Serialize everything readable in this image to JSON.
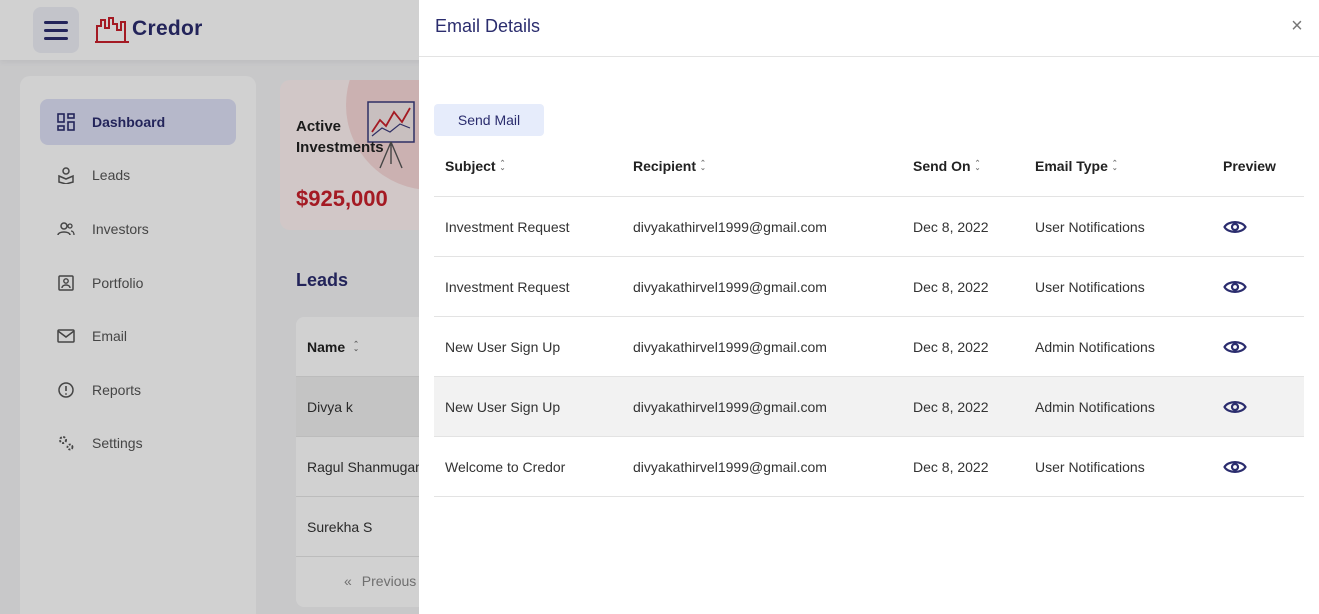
{
  "app": {
    "brand": "Credor",
    "colors": {
      "primary": "#2b2d6e",
      "accent_red": "#c8202b",
      "active_nav_bg": "#dfe1f7"
    }
  },
  "sidebar": {
    "items": [
      {
        "label": "Dashboard",
        "icon": "dashboard-icon",
        "active": true
      },
      {
        "label": "Leads",
        "icon": "leads-icon"
      },
      {
        "label": "Investors",
        "icon": "investors-icon"
      },
      {
        "label": "Portfolio",
        "icon": "portfolio-icon"
      },
      {
        "label": "Email",
        "icon": "email-icon"
      },
      {
        "label": "Reports",
        "icon": "reports-icon"
      },
      {
        "label": "Settings",
        "icon": "settings-icon"
      }
    ]
  },
  "dashboard": {
    "active_investments": {
      "title": "Active Investments",
      "amount": "$925,000"
    },
    "leads": {
      "title": "Leads",
      "column_name": "Name",
      "rows": [
        "Divya k",
        "Ragul Shanmugam",
        "Surekha S"
      ],
      "pagination_prev": "Previous"
    }
  },
  "drawer": {
    "title": "Email Details",
    "close_label": "×",
    "send_mail_label": "Send Mail",
    "columns": {
      "subject": "Subject",
      "recipient": "Recipient",
      "send_on": "Send On",
      "email_type": "Email Type",
      "preview": "Preview"
    },
    "rows": [
      {
        "subject": "Investment Request",
        "recipient": "divyakathirvel1999@gmail.com",
        "send_on": "Dec 8, 2022",
        "email_type": "User Notifications"
      },
      {
        "subject": "Investment Request",
        "recipient": "divyakathirvel1999@gmail.com",
        "send_on": "Dec 8, 2022",
        "email_type": "User Notifications"
      },
      {
        "subject": "New User Sign Up",
        "recipient": "divyakathirvel1999@gmail.com",
        "send_on": "Dec 8, 2022",
        "email_type": "Admin Notifications"
      },
      {
        "subject": "New User Sign Up",
        "recipient": "divyakathirvel1999@gmail.com",
        "send_on": "Dec 8, 2022",
        "email_type": "Admin Notifications"
      },
      {
        "subject": "Welcome to Credor",
        "recipient": "divyakathirvel1999@gmail.com",
        "send_on": "Dec 8, 2022",
        "email_type": "User Notifications"
      }
    ]
  }
}
